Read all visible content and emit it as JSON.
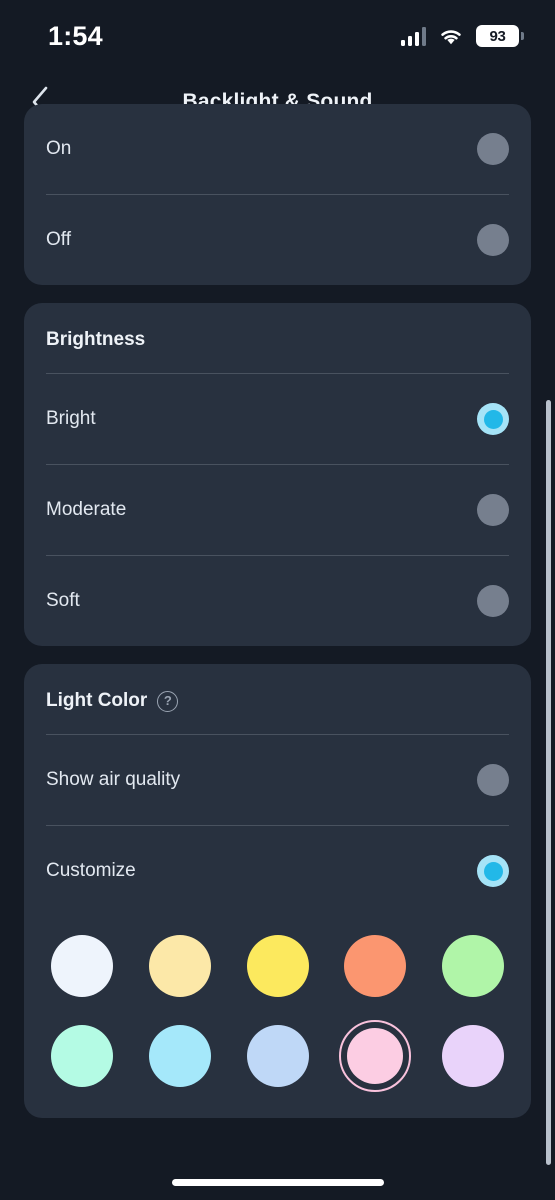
{
  "status_bar": {
    "time": "1:54",
    "battery_level": "93",
    "signal_icon": "cellular-signal-icon",
    "wifi_icon": "wifi-icon",
    "battery_icon": "battery-icon"
  },
  "nav": {
    "back_icon": "chevron-left-icon",
    "title": "Backlight & Sound"
  },
  "sections": {
    "backlight": {
      "rows": [
        {
          "label": "On",
          "selected": false
        },
        {
          "label": "Off",
          "selected": false
        }
      ]
    },
    "brightness": {
      "title": "Brightness",
      "rows": [
        {
          "label": "Bright",
          "selected": true
        },
        {
          "label": "Moderate",
          "selected": false
        },
        {
          "label": "Soft",
          "selected": false
        }
      ]
    },
    "light_color": {
      "title": "Light Color",
      "help_icon": "question-mark-circle-icon",
      "rows": [
        {
          "label": "Show air quality",
          "selected": false
        },
        {
          "label": "Customize",
          "selected": true
        }
      ],
      "swatch_rows": [
        [
          {
            "name": "color-white",
            "hex": "#eef4fc",
            "selected": false
          },
          {
            "name": "color-cream",
            "hex": "#fce8a8",
            "selected": false
          },
          {
            "name": "color-yellow",
            "hex": "#fce95e",
            "selected": false
          },
          {
            "name": "color-salmon",
            "hex": "#fb9670",
            "selected": false
          },
          {
            "name": "color-light-green",
            "hex": "#b0f5a8",
            "selected": false
          }
        ],
        [
          {
            "name": "color-mint",
            "hex": "#b4fbe4",
            "selected": false
          },
          {
            "name": "color-sky-blue",
            "hex": "#a5e8fa",
            "selected": false
          },
          {
            "name": "color-periwinkle",
            "hex": "#bfd8f7",
            "selected": false
          },
          {
            "name": "color-pink",
            "hex": "#fccde3",
            "selected": true
          },
          {
            "name": "color-lavender",
            "hex": "#e9d3fa",
            "selected": false
          }
        ]
      ]
    }
  },
  "colors": {
    "page_background": "#141a24",
    "card_background": "#28313f",
    "accent": "#22b8e8",
    "accent_ring": "#a5e3f7",
    "radio_off": "#767f8e",
    "divider": "#49525f",
    "text_primary": "#eef2f7",
    "selection_ring": "#f9c2dc"
  },
  "scrollbar": {
    "name": "vertical-scrollbar"
  },
  "home_indicator": {
    "name": "home-indicator"
  }
}
